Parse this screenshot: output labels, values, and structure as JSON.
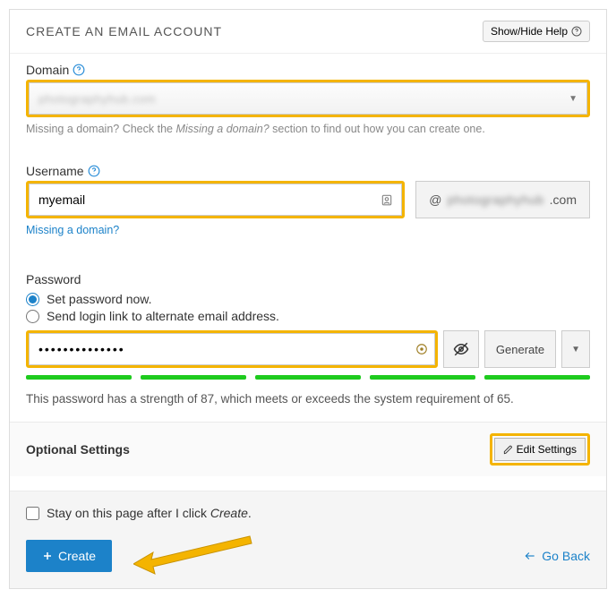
{
  "header": {
    "title": "CREATE AN EMAIL ACCOUNT",
    "helpButton": "Show/Hide Help"
  },
  "domain": {
    "label": "Domain",
    "selectedMasked": "photographyhub.com",
    "hintPrefix": "Missing a domain? Check the ",
    "hintEm": "Missing a domain?",
    "hintSuffix": " section to find out how you can create one."
  },
  "username": {
    "label": "Username",
    "value": "myemail",
    "atPrefix": "@",
    "atDomainMasked": "photographyhub",
    "atSuffix": ".com",
    "missingLink": "Missing a domain?"
  },
  "password": {
    "label": "Password",
    "optionNow": "Set password now.",
    "optionLink": "Send login link to alternate email address.",
    "value": "••••••••••••••",
    "generate": "Generate",
    "strengthText": "This password has a strength of 87, which meets or exceeds the system requirement of 65."
  },
  "optional": {
    "title": "Optional Settings",
    "editButton": "Edit Settings"
  },
  "footer": {
    "stayPrefix": "Stay on this page after I click ",
    "stayEm": "Create",
    "staySuffix": ".",
    "create": "Create",
    "goBack": "Go Back"
  }
}
